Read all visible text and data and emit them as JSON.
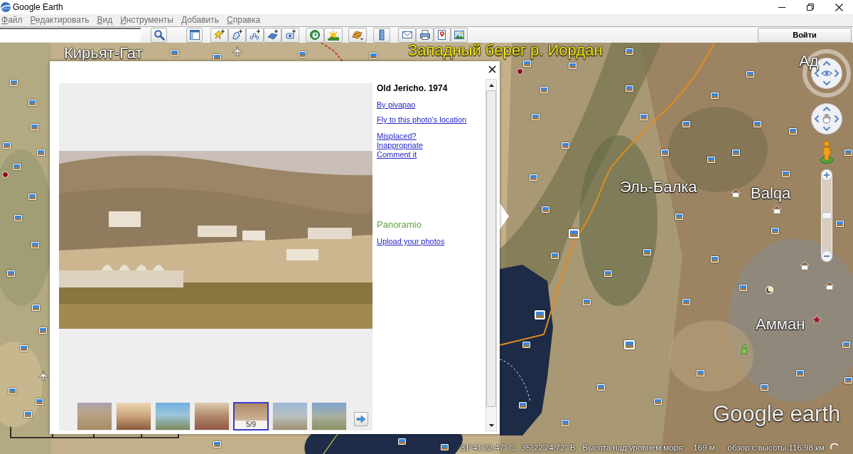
{
  "window": {
    "title": "Google Earth"
  },
  "menu": [
    "Файл",
    "Редактировать",
    "Вид",
    "Инструменты",
    "Добавить",
    "Справка"
  ],
  "toolbar": {
    "sign_in_button": "Войти"
  },
  "map_labels": [
    {
      "text": "Кирьят-Гат",
      "kind": "place"
    },
    {
      "text": "Западный берег р. Иордан",
      "kind": "region"
    },
    {
      "text": "Ад",
      "kind": "place"
    },
    {
      "text": "Эль-Балка",
      "kind": "place"
    },
    {
      "text": "Balqa",
      "kind": "place"
    },
    {
      "text": "Амман",
      "kind": "place"
    }
  ],
  "navigation": {
    "zoom": {
      "level": 0.5
    }
  },
  "popup": {
    "title": "Old Jericho. 1974",
    "author_link": "By pivapao",
    "fly_to_link": "Fly to this photo's location",
    "report_links": [
      "Misplaced?",
      "Inappropriate",
      "Comment it"
    ],
    "brand": "Panoramio",
    "upload_link": "Upload your photos",
    "photo_counter": "5/9",
    "thumbnails": [
      {
        "selected": false
      },
      {
        "selected": false
      },
      {
        "selected": false
      },
      {
        "selected": false
      },
      {
        "selected": true
      },
      {
        "selected": false
      },
      {
        "selected": false
      }
    ]
  },
  "logo": "Google earth",
  "status_bar": {
    "latitude": "31°41'22.47\" С",
    "longitude": "35°22'24.72\" В",
    "elevation_label": "Высота над уровнем моря:",
    "elevation": "169 м",
    "eye_altitude": "обзор с высоты 116.98 км"
  }
}
